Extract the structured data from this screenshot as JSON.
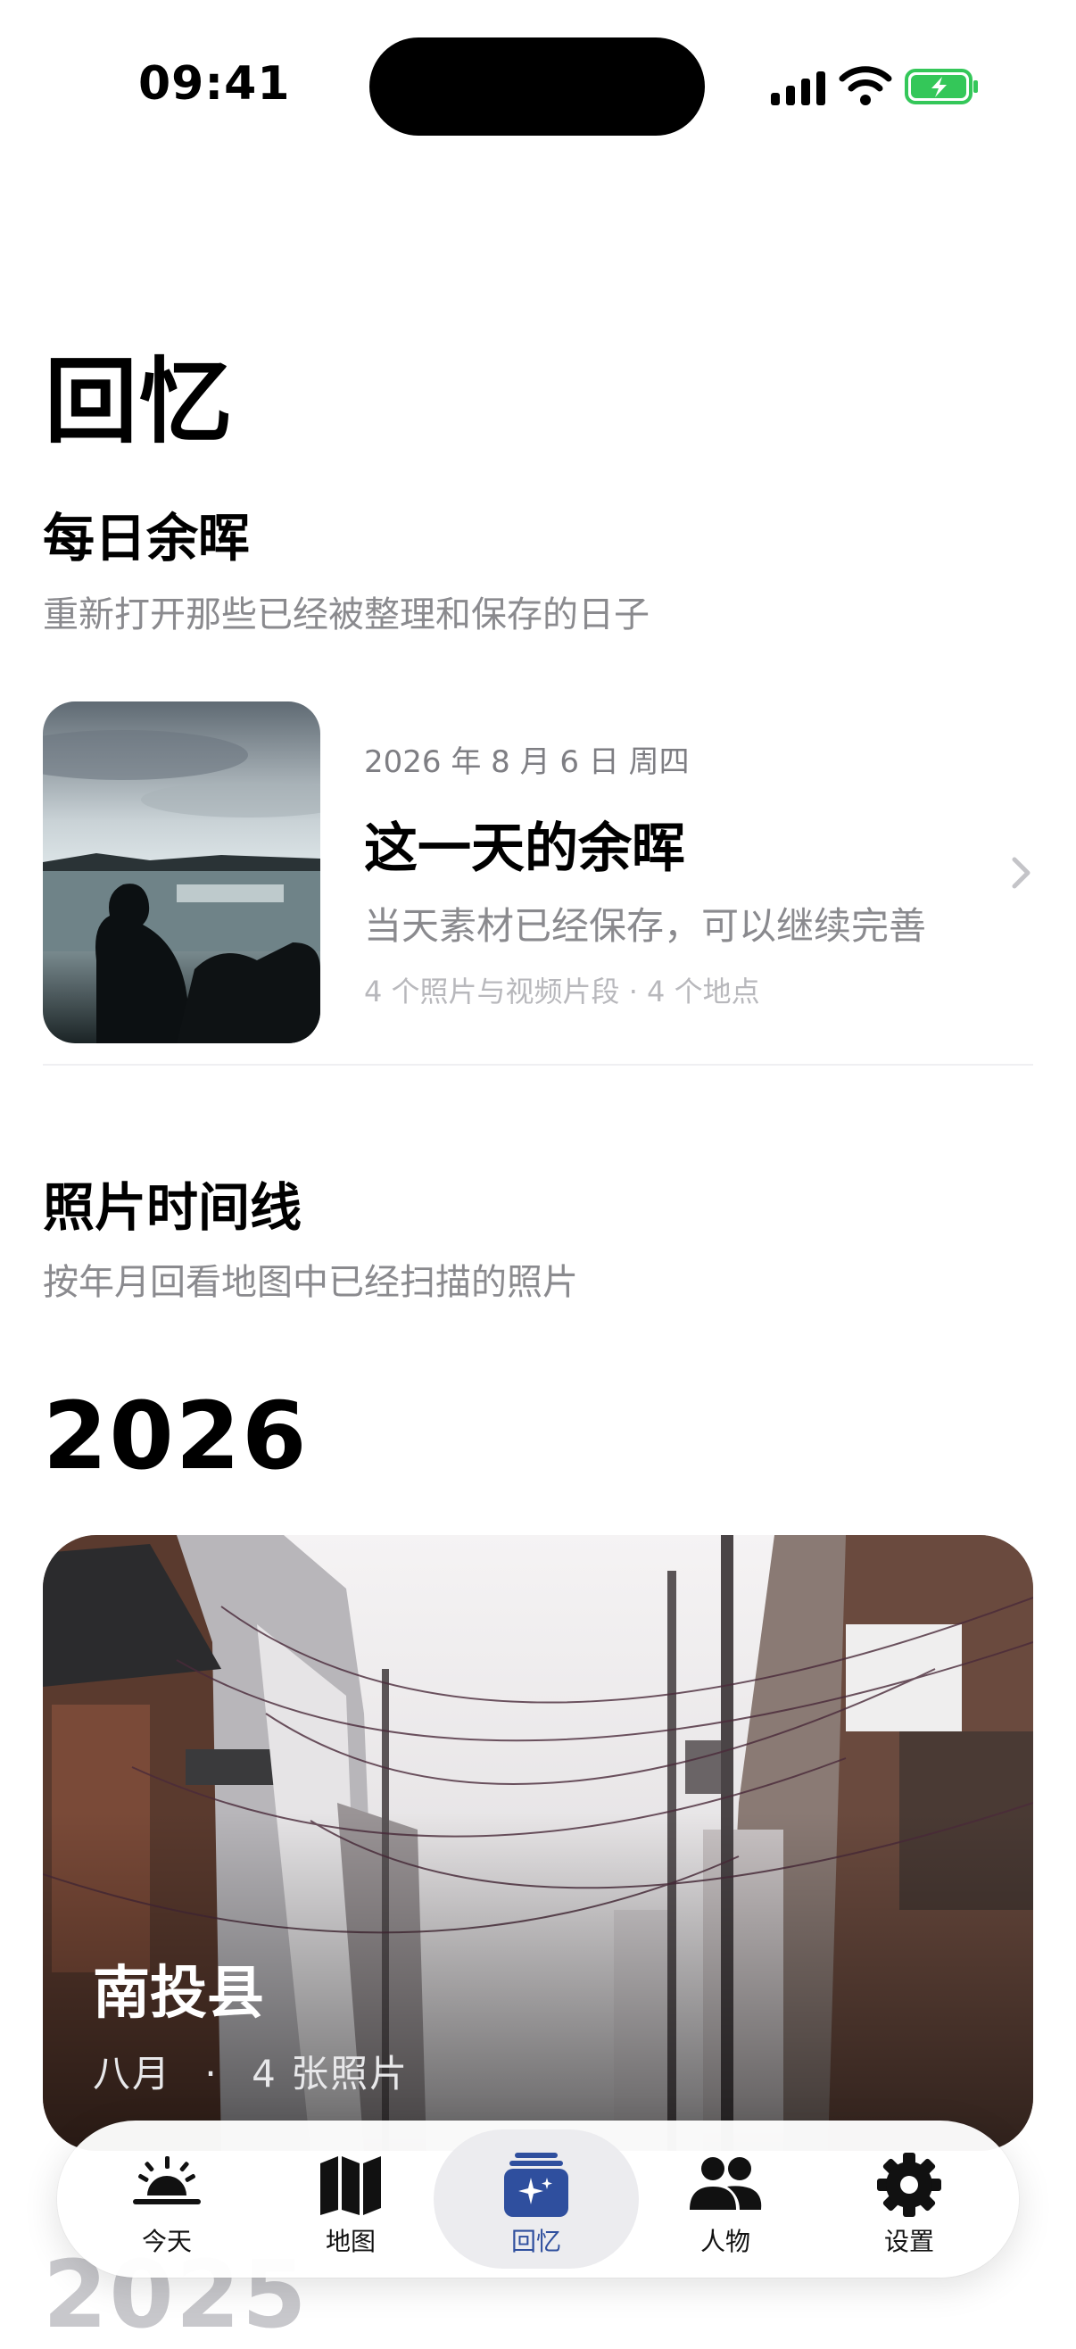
{
  "status_bar": {
    "time": "09:41"
  },
  "page": {
    "title": "回忆"
  },
  "daily": {
    "title": "每日余晖",
    "subtitle": "重新打开那些已经被整理和保存的日子",
    "card": {
      "date": "2026 年 8 月 6 日 周四",
      "title": "这一天的余晖",
      "description": "当天素材已经保存，可以继续完善",
      "meta": "4 个照片与视频片段 · 4 个地点"
    }
  },
  "timeline": {
    "title": "照片时间线",
    "subtitle": "按年月回看地图中已经扫描的照片",
    "years": [
      {
        "year": "2026",
        "card": {
          "place": "南投县",
          "month": "八月",
          "separator": "·",
          "count": "4 张照片"
        }
      },
      {
        "year": "2025"
      }
    ]
  },
  "tabs": [
    {
      "label": "今天",
      "icon": "sunrise-icon",
      "active": false
    },
    {
      "label": "地图",
      "icon": "map-icon",
      "active": false
    },
    {
      "label": "回忆",
      "icon": "memories-icon",
      "active": true
    },
    {
      "label": "人物",
      "icon": "people-icon",
      "active": false
    },
    {
      "label": "设置",
      "icon": "gear-icon",
      "active": false
    }
  ],
  "colors": {
    "accent": "#2f4f9e",
    "secondary_text": "#8a8a8e",
    "battery": "#34c759"
  }
}
